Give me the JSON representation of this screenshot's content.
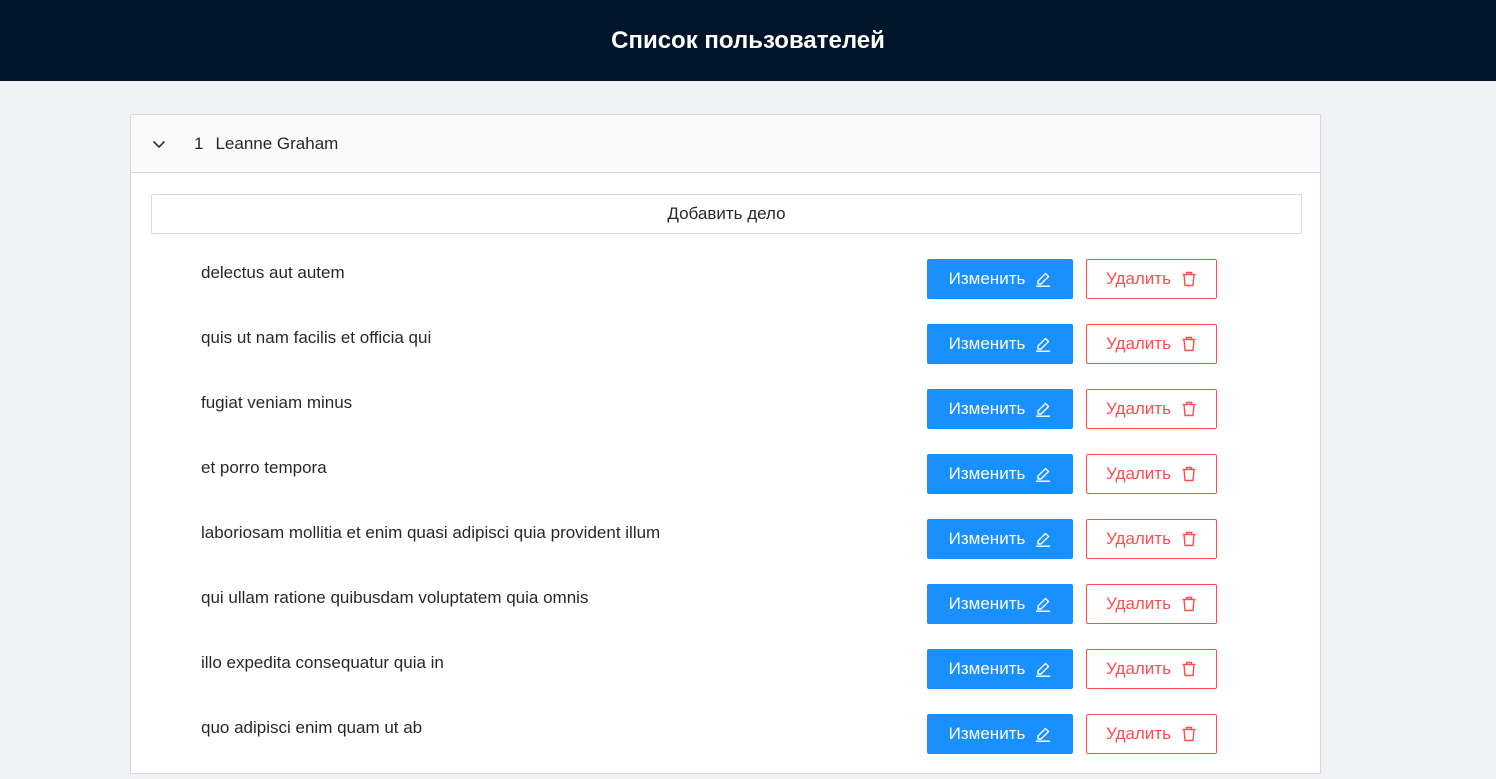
{
  "header": {
    "title": "Список пользователей"
  },
  "user": {
    "id": "1",
    "name": "Leanne Graham",
    "expand_icon": "chevron-down-icon"
  },
  "add_todo_label": "Добавить дело",
  "actions": {
    "edit_label": "Изменить",
    "edit_icon": "edit-icon",
    "delete_label": "Удалить",
    "delete_icon": "trash-icon"
  },
  "todos": [
    {
      "title": "delectus aut autem"
    },
    {
      "title": "quis ut nam facilis et officia qui"
    },
    {
      "title": "fugiat veniam minus"
    },
    {
      "title": "et porro tempora"
    },
    {
      "title": "laboriosam mollitia et enim quasi adipisci quia provident illum"
    },
    {
      "title": "qui ullam ratione quibusdam voluptatem quia omnis"
    },
    {
      "title": "illo expedita consequatur quia in"
    },
    {
      "title": "quo adipisci enim quam ut ab"
    }
  ],
  "colors": {
    "header_bg": "#001529",
    "primary": "#1890ff",
    "danger": "#ff4d4f",
    "page_bg": "#f0f2f5"
  }
}
